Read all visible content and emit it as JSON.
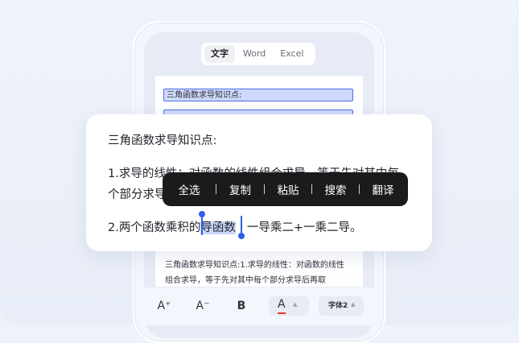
{
  "tabs": [
    {
      "label": "文字",
      "active": true
    },
    {
      "label": "Word",
      "active": false
    },
    {
      "label": "Excel",
      "active": false
    }
  ],
  "doc": {
    "heading": "三角函数求导知识点:",
    "paragraph": "三角函数求导知识点:1.求导的线性：对函数的线性组合求导，等于先对其中每个部分求导后再取"
  },
  "card": {
    "line1": "三角函数求导知识点:",
    "line2a": "1.求导的线性：对函数的线性组合求导，等于先对其中每",
    "line2b": "个部分求导后再取线性组合。",
    "line3_before": "2.两个函数乘积的",
    "line3_selected": "导函数",
    "line3_after": "一导乘二+一乘二导。"
  },
  "context_menu": {
    "items": [
      "全选",
      "复制",
      "粘贴",
      "搜索",
      "翻译"
    ]
  },
  "toolbar": {
    "increase_font": "A⁺",
    "decrease_font": "A⁻",
    "bold": "B",
    "font_color": "A",
    "font_size_label": "字体2"
  },
  "colors": {
    "accent": "#2f5fe5",
    "selection": "#c9d7fb",
    "menu_bg": "#1b1b1d",
    "font_color_underline": "#e53935"
  }
}
